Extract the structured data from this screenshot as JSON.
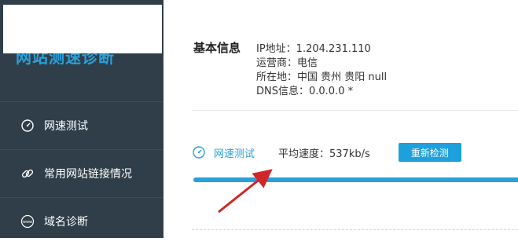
{
  "logo": {
    "text": "网站测速诊断"
  },
  "nav": {
    "items": [
      {
        "label": "网速测试",
        "icon": "speedometer-icon"
      },
      {
        "label": "常用网站链接情况",
        "icon": "link-icon"
      },
      {
        "label": "域名诊断",
        "icon": "www-icon"
      }
    ]
  },
  "basic": {
    "title": "基本信息",
    "ip": "IP地址：1.204.231.110",
    "isp": "运营商：电信",
    "location": "所在地：中国 贵州 贵阳 null",
    "dns": "DNS信息：0.0.0.0 *"
  },
  "speed": {
    "title": "网速测试",
    "avg": "平均速度：537kb/s",
    "retest_label": "重新检测",
    "progress": 1.0
  },
  "colors": {
    "accent": "#2aa0da",
    "sidebar": "#2f3e48",
    "arrow": "#d0262a"
  }
}
